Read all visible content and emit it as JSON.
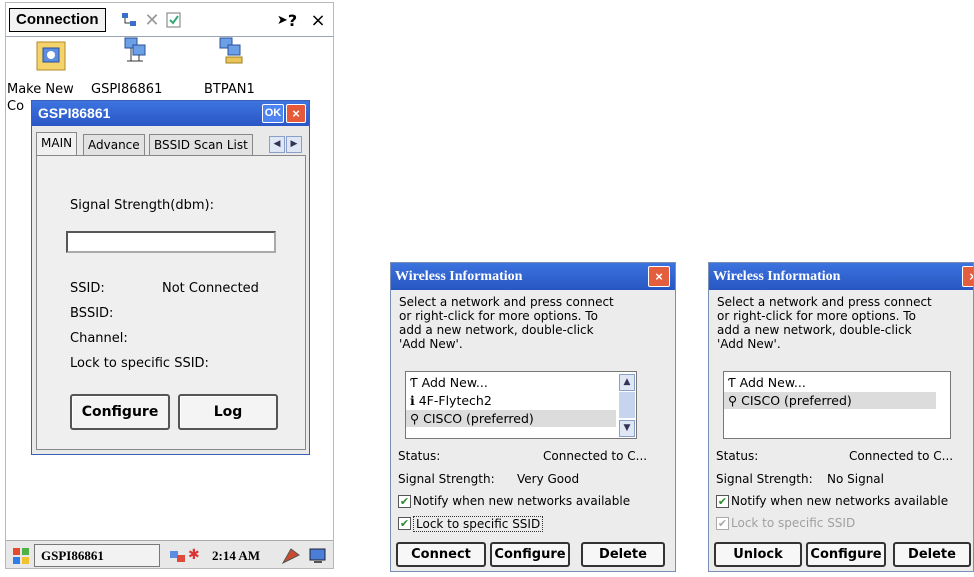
{
  "left": {
    "toolbar": {
      "connection": "Connection",
      "help": "?",
      "close": "×"
    },
    "desktop": [
      {
        "label": "Make New",
        "label2": "Co"
      },
      {
        "label": "GSPI86861"
      },
      {
        "label": "BTPAN1"
      }
    ],
    "dialog": {
      "title": "GSPI86861",
      "ok": "OK",
      "close": "×",
      "tabs": [
        "MAIN",
        "Advance",
        "BSSID Scan List"
      ],
      "signal_label": "Signal Strength(dbm):",
      "ssid_label": "SSID:",
      "ssid_value": "Not Connected",
      "bssid_label": "BSSID:",
      "channel_label": "Channel:",
      "lock_label": "Lock to specific SSID:",
      "configure": "Configure",
      "log": "Log"
    },
    "taskbar": {
      "adapter": "GSPI86861",
      "time": "2:14 AM"
    }
  },
  "wireless_a": {
    "title": "Wireless Information",
    "close": "×",
    "desc": [
      "Select a network and press connect",
      "or right-click for more options.  To",
      "add a new network, double-click",
      "'Add New'."
    ],
    "items": [
      "Add New...",
      "4F-Flytech2",
      "CISCO (preferred)"
    ],
    "status_label": "Status:",
    "status_value": "Connected to C...",
    "signal_label": "Signal Strength:",
    "signal_value": "Very Good",
    "notify": "Notify when new networks available",
    "lock": "Lock to specific SSID",
    "buttons": [
      "Connect",
      "Configure",
      "Delete"
    ]
  },
  "wireless_b": {
    "title": "Wireless Information",
    "close": "×",
    "desc": [
      "Select a network and press connect",
      "or right-click for more options.  To",
      "add a new network, double-click",
      "'Add New'."
    ],
    "items": [
      "Add New...",
      "CISCO (preferred)"
    ],
    "status_label": "Status:",
    "status_value": "Connected to C...",
    "signal_label": "Signal Strength:",
    "signal_value": "No Signal",
    "notify": "Notify when new networks available",
    "lock": "Lock to specific SSID",
    "buttons": [
      "Unlock",
      "Configure",
      "Delete"
    ]
  },
  "colors": {
    "titlebar": "#2f63d2",
    "close": "#e45e3e",
    "check": "#2a8a2a"
  }
}
